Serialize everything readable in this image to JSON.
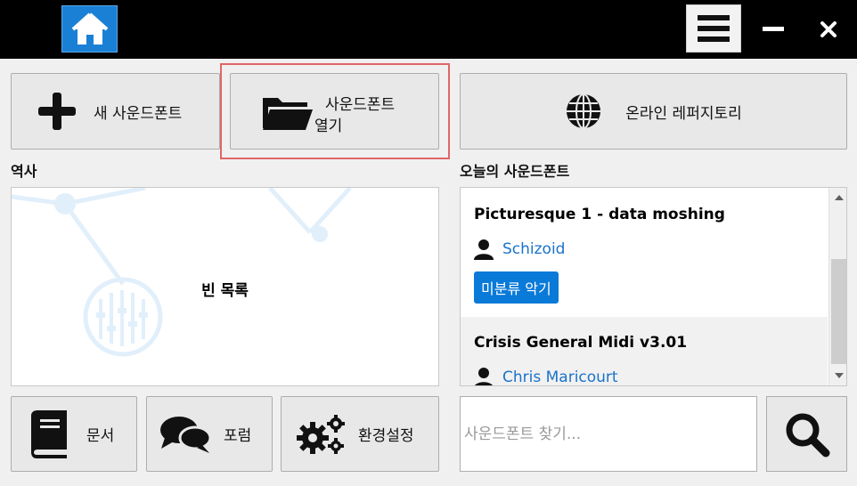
{
  "titlebar": {
    "home_icon": "home-icon",
    "menu_icon": "hamburger-menu-icon",
    "minimize_icon": "minimize-icon",
    "close_icon": "close-icon"
  },
  "actions": {
    "new_soundfont": "새 사운드폰트",
    "open_soundfont_line1": "사운드폰트",
    "open_soundfont_line2": "열기",
    "online_repository": "온라인 레퍼지토리"
  },
  "history": {
    "label": "역사",
    "empty_text": "빈 목록"
  },
  "today": {
    "label": "오늘의 사운드폰트",
    "items": [
      {
        "title": "Picturesque 1 - data moshing",
        "author": "Schizoid",
        "tag": "미분류 악기"
      },
      {
        "title": "Crisis General Midi v3.01",
        "author": "Chris Maricourt"
      }
    ]
  },
  "bottom": {
    "docs": "문서",
    "forum": "포럼",
    "settings": "환경설정"
  },
  "search": {
    "placeholder": "사운드폰트 찾기..."
  },
  "colors": {
    "accent": "#1a80d6",
    "link": "#1a73c9",
    "tag": "#0a7ad8",
    "highlight": "#e06666"
  }
}
